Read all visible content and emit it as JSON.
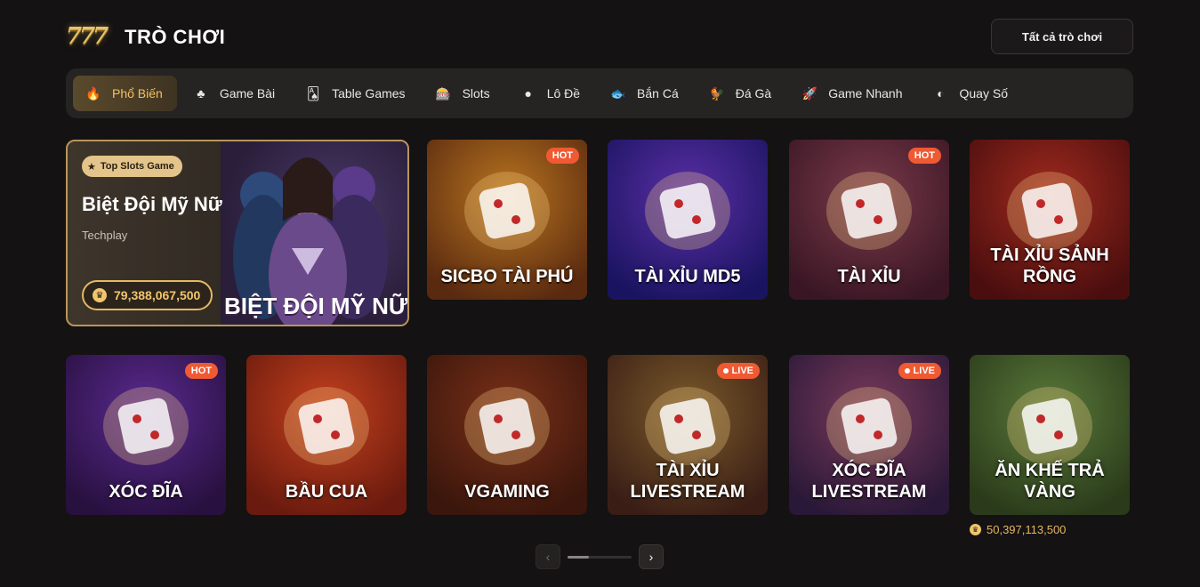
{
  "header": {
    "logo_text": "777",
    "title": "TRÒ CHƠI",
    "all_games_label": "Tất cả trò chơi"
  },
  "tabs": [
    {
      "label": "Phổ Biến",
      "icon": "flame-icon",
      "glyph": "🔥",
      "active": true
    },
    {
      "label": "Game Bài",
      "icon": "cards-icon",
      "glyph": "♣"
    },
    {
      "label": "Table Games",
      "icon": "table-games-icon",
      "glyph": "🂡"
    },
    {
      "label": "Slots",
      "icon": "slot-machine-icon",
      "glyph": "🎰"
    },
    {
      "label": "Lô Đề",
      "icon": "lottery-ball-icon",
      "glyph": "●"
    },
    {
      "label": "Bắn Cá",
      "icon": "fish-icon",
      "glyph": "🐟"
    },
    {
      "label": "Đá Gà",
      "icon": "rooster-icon",
      "glyph": "🐓"
    },
    {
      "label": "Game Nhanh",
      "icon": "rocket-icon",
      "glyph": "🚀"
    },
    {
      "label": "Quay Số",
      "icon": "wheel-icon",
      "glyph": "◐"
    }
  ],
  "featured": {
    "tag": "Top Slots Game",
    "title": "Biệt Đội Mỹ Nữ",
    "provider": "Techplay",
    "jackpot": "79,388,067,500",
    "banner": "BIỆT ĐỘI MỸ NỮ"
  },
  "games": [
    {
      "name": "SICBO TÀI PHÚ",
      "badge": "HOT",
      "colors": [
        "#b8741f",
        "#5a2a10"
      ]
    },
    {
      "name": "TÀI XỈU MD5",
      "badge": "",
      "colors": [
        "#5b2fa6",
        "#1a1460"
      ]
    },
    {
      "name": "TÀI XỈU",
      "badge": "HOT",
      "colors": [
        "#7a3a4a",
        "#3a1624"
      ]
    },
    {
      "name": "TÀI XỈU SẢNH RỒNG",
      "badge": "",
      "colors": [
        "#a02a1e",
        "#4a0e0e"
      ]
    },
    {
      "name": "XÓC ĐĨA",
      "badge": "HOT",
      "colors": [
        "#5a2a90",
        "#28103f"
      ]
    },
    {
      "name": "BẦU CUA",
      "badge": "",
      "colors": [
        "#c4411e",
        "#6a1a0e"
      ]
    },
    {
      "name": "VGAMING",
      "badge": "",
      "colors": [
        "#7a3018",
        "#3a160c"
      ]
    },
    {
      "name": "TÀI XỈU LIVESTREAM",
      "badge": "LIVE",
      "colors": [
        "#7a5a2a",
        "#3a1e16"
      ]
    },
    {
      "name": "XÓC ĐĨA LIVESTREAM",
      "badge": "LIVE",
      "colors": [
        "#7a3a5a",
        "#2a1838"
      ]
    },
    {
      "name": "ĂN KHẾ TRẢ VÀNG",
      "badge": "",
      "colors": [
        "#5a7a3a",
        "#2a3a1a"
      ]
    }
  ],
  "small_jackpot": "50,397,113,500",
  "pager": {
    "prev": "‹",
    "next": "›"
  }
}
